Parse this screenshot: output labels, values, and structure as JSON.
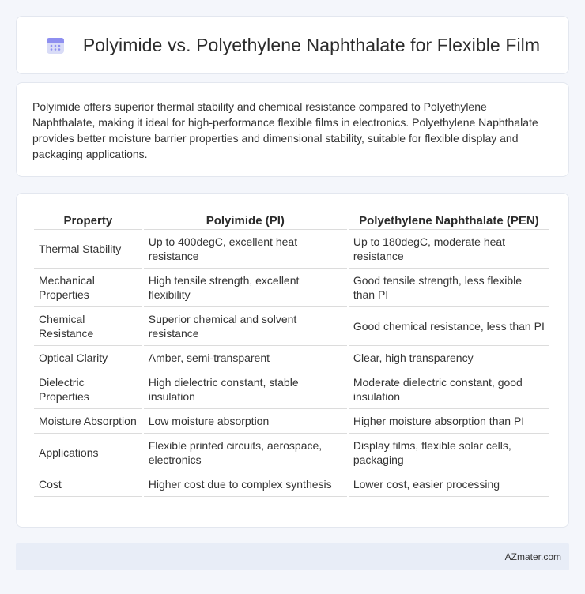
{
  "header": {
    "title": "Polyimide vs. Polyethylene Naphthalate for Flexible Film",
    "icon": "calendar-grid-icon"
  },
  "summary": {
    "text": "Polyimide offers superior thermal stability and chemical resistance compared to Polyethylene Naphthalate, making it ideal for high-performance flexible films in electronics. Polyethylene Naphthalate provides better moisture barrier properties and dimensional stability, suitable for flexible display and packaging applications."
  },
  "table": {
    "headers": [
      "Property",
      "Polyimide (PI)",
      "Polyethylene Naphthalate (PEN)"
    ],
    "rows": [
      [
        "Thermal Stability",
        "Up to 400degC, excellent heat resistance",
        "Up to 180degC, moderate heat resistance"
      ],
      [
        "Mechanical Properties",
        "High tensile strength, excellent flexibility",
        "Good tensile strength, less flexible than PI"
      ],
      [
        "Chemical Resistance",
        "Superior chemical and solvent resistance",
        "Good chemical resistance, less than PI"
      ],
      [
        "Optical Clarity",
        "Amber, semi-transparent",
        "Clear, high transparency"
      ],
      [
        "Dielectric Properties",
        "High dielectric constant, stable insulation",
        "Moderate dielectric constant, good insulation"
      ],
      [
        "Moisture Absorption",
        "Low moisture absorption",
        "Higher moisture absorption than PI"
      ],
      [
        "Applications",
        "Flexible printed circuits, aerospace, electronics",
        "Display films, flexible solar cells, packaging"
      ],
      [
        "Cost",
        "Higher cost due to complex synthesis",
        "Lower cost, easier processing"
      ]
    ]
  },
  "footer": {
    "brand": "AZmater.com"
  },
  "colors": {
    "background": "#f4f6fb",
    "card": "#ffffff",
    "footer_bg": "#e8edf7",
    "icon_accent": "#8e8ff0"
  }
}
